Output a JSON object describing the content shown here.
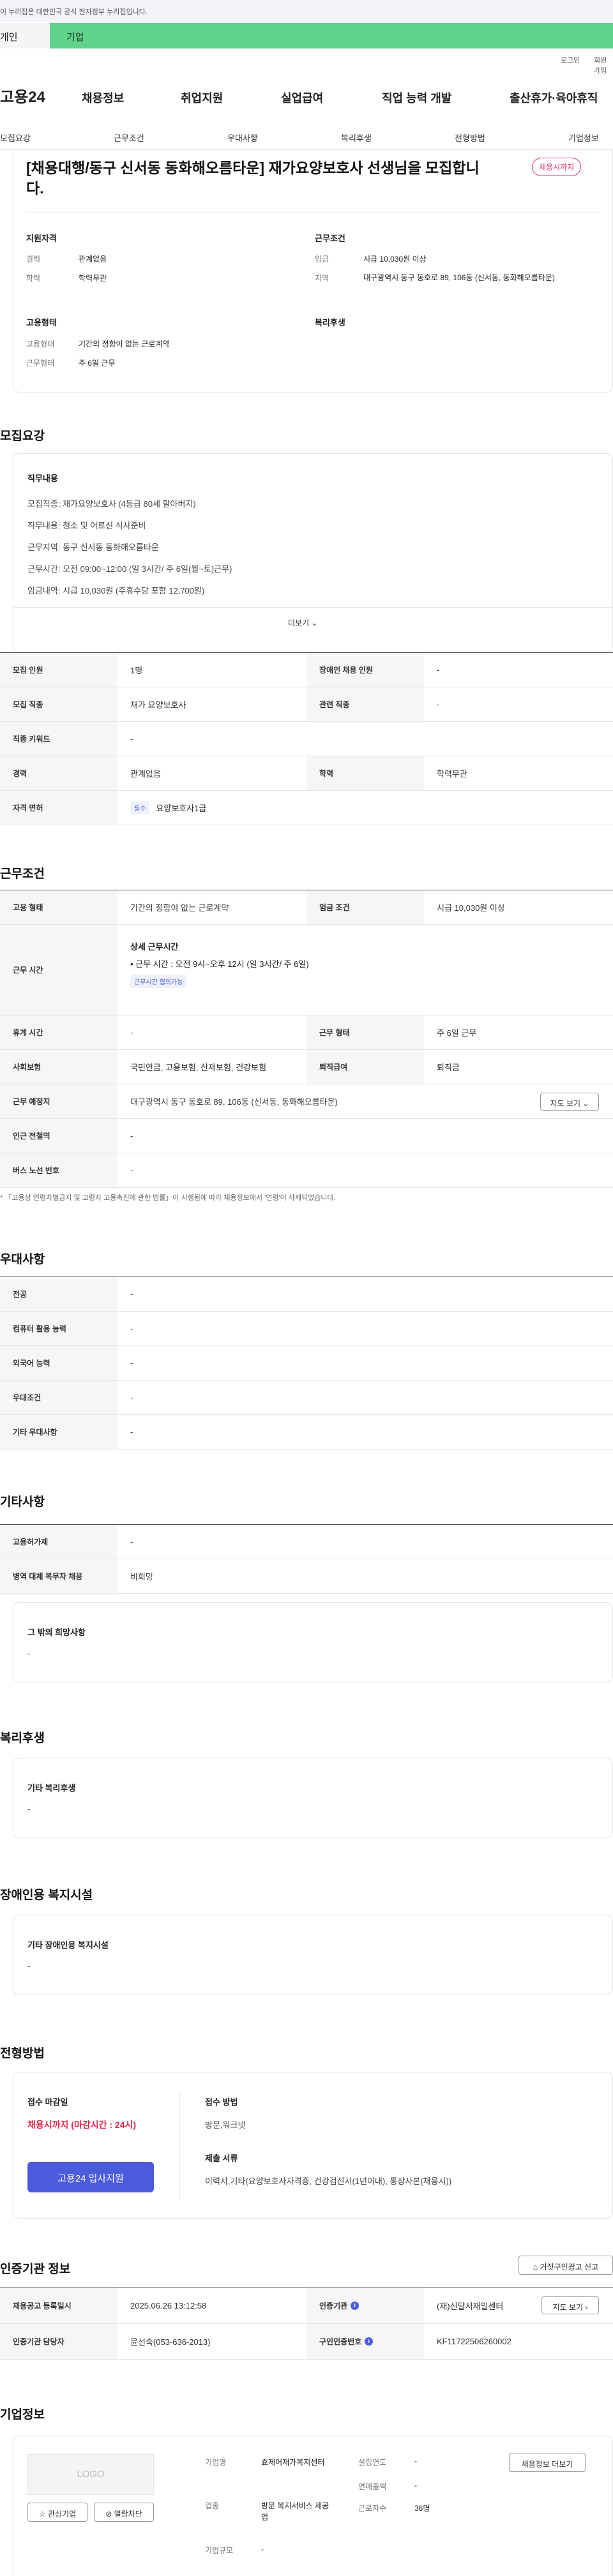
{
  "gov_banner": "이 누리집은 대한민국 공식 전자정부 누리집입니다.",
  "user_tabs": {
    "individual": "개인",
    "corporate": "기업"
  },
  "util": {
    "login": "로그인",
    "join": "회원가입"
  },
  "logo": "고용24",
  "gnb": [
    "채용정보",
    "취업지원",
    "실업급여",
    "직업 능력 개발",
    "출산휴가·육아휴직"
  ],
  "subnav": [
    "모집요강",
    "근무조건",
    "우대사항",
    "복리후생",
    "전형방법",
    "기업정보"
  ],
  "job": {
    "title": "[채용대행/동구 신서동 동화해오름타운] 재가요양보호사 선생님을 모집합니다.",
    "status_badge": "채용시까지",
    "qual_title": "지원자격",
    "qual": [
      {
        "k": "경력",
        "v": "관계없음"
      },
      {
        "k": "학력",
        "v": "학력무관"
      }
    ],
    "emp_title": "고용형태",
    "emp": [
      {
        "k": "고용형태",
        "v": "기간의 정함이 없는 근로계약"
      },
      {
        "k": "근무형태",
        "v": "주 6일 근무"
      }
    ],
    "cond_title": "근무조건",
    "cond": [
      {
        "k": "임금",
        "v": "시급 10,030원 이상"
      },
      {
        "k": "지역",
        "v": "대구광역시 동구 동호로 89, 106동 (신서동, 동화해오름타운)"
      }
    ],
    "welfare_title": "복리후생"
  },
  "recruit": {
    "section_title": "모집요강",
    "duty_title": "직무내용",
    "duty_lines": [
      "모집직종: 재가요양보호사 (4등급 80세 할아버지)",
      "직무내용: 청소 및 어르신 식사준비",
      "근무지역: 동구 신서동 동화해오름타운",
      "근무시간: 오전 09:00~12:00 (일 3시간/ 주 6일(월~토)근무)",
      "임금내역: 시급 10,030원 (주휴수당 포함 12,700원)"
    ],
    "more": "더보기",
    "rows": [
      {
        "k1": "모집 인원",
        "v1": "1명",
        "k2": "장애인 채용 인원",
        "v2": "-"
      },
      {
        "k1": "모집 직종",
        "v1": "재가 요양보호사",
        "k2": "관련 직종",
        "v2": "-"
      },
      {
        "k1": "직종 키워드",
        "v1": "-"
      },
      {
        "k1": "경력",
        "v1": "관계없음",
        "k2": "학력",
        "v2": "학력무관"
      },
      {
        "k1": "자격 면허",
        "tag": "필수",
        "v1": "요양보호사1급"
      }
    ]
  },
  "work": {
    "section_title": "근무조건",
    "r1": {
      "k1": "고용 형태",
      "v1": "기간의 정함이 없는 근로계약",
      "k2": "임금 조건",
      "v2": "시급 10,030원 이상"
    },
    "r2": {
      "k1": "근무 시간",
      "title": "상세 근무시간",
      "line": "• 근무 시간 : 오전 9시~오후 12시 (일 3시간/ 주 6일)",
      "tag": "근무시간 협의가능"
    },
    "r3": {
      "k1": "휴게 시간",
      "v1": "-",
      "k2": "근무 형태",
      "v2": "주 6일 근무"
    },
    "r4": {
      "k1": "사회보험",
      "v1": "국민연금, 고용보험, 산재보험, 건강보험",
      "k2": "퇴직급여",
      "v2": "퇴직금"
    },
    "r5": {
      "k1": "근무 예정지",
      "v1": "대구광역시 동구 동호로 89, 106동 (신서동, 동화해오름타운)",
      "btn": "지도 보기"
    },
    "r6": {
      "k1": "인근 전철역",
      "v1": "-"
    },
    "r7": {
      "k1": "버스 노선 번호",
      "v1": "-"
    },
    "note": "* 「고용상 연령차별금지 및 고령자 고용촉진에 관한 법률」이 시행됨에 따라 채용정보에서 '연령'이 삭제되었습니다."
  },
  "pref": {
    "section_title": "우대사항",
    "rows": [
      {
        "k": "전공",
        "v": "-"
      },
      {
        "k": "컴퓨터 활용 능력",
        "v": "-"
      },
      {
        "k": "외국어 능력",
        "v": "-"
      },
      {
        "k": "우대조건",
        "v": "-"
      },
      {
        "k": "기타 우대사항",
        "v": "-"
      }
    ]
  },
  "etc": {
    "section_title": "기타사항",
    "rows": [
      {
        "k": "고용허가제",
        "v": "-"
      },
      {
        "k": "병역 대체 복무자 채용",
        "v": "비희망"
      }
    ],
    "box_title": "그 밖의 희망사항",
    "box_value": "-"
  },
  "welfare": {
    "section_title": "복리후생",
    "box_title": "기타 복리후생",
    "box_value": "-"
  },
  "disabled": {
    "section_title": "장애인용 복지시설",
    "box_title": "기타 장애인용 복지시설",
    "box_value": "-"
  },
  "apply": {
    "section_title": "전형방법",
    "deadline_label": "접수 마감일",
    "deadline": "채용시까지 (마감시간 : 24시)",
    "apply_btn": "고용24 입사지원",
    "method_label": "접수 방법",
    "method": "방문,워크넷",
    "docs_label": "제출 서류",
    "docs": "이력서,기타(요양보호사자격증, 건강검진서(1년이내), 통장사본(채용시))"
  },
  "cert": {
    "section_title": "인증기관 정보",
    "report_btn": "거짓구인광고 신고",
    "rows": [
      {
        "k1": "채용공고 등록일시",
        "v1": "2025.06.26 13:12:58",
        "k2": "인증기관",
        "v2": "(재)신달서재일센터",
        "btn": "지도 보기"
      },
      {
        "k1": "인증기관 담당자",
        "v1": "윤선숙(053-636-2013)",
        "k2": "구인인증번호",
        "v2": "KF11722506260002"
      }
    ]
  },
  "company": {
    "section_title": "기업정보",
    "logo_text": "LOGO",
    "btn_interest": "관심기업",
    "btn_block": "열람차단",
    "name_label": "기업명",
    "name": "효제어재가복지센터",
    "industry_label": "업종",
    "industry": "방문 복지서비스 제공업",
    "size_label": "기업규모",
    "size": "-",
    "founded_label": "설립연도",
    "founded": "-",
    "revenue_label": "연매출액",
    "revenue": "-",
    "employees_label": "근로자수",
    "employees": "36명",
    "detail_btn": "채용정보 더보기"
  },
  "colors": {
    "accent": "#4a5bdc",
    "red": "#e3264a",
    "green_tab": "#5fd38a"
  }
}
